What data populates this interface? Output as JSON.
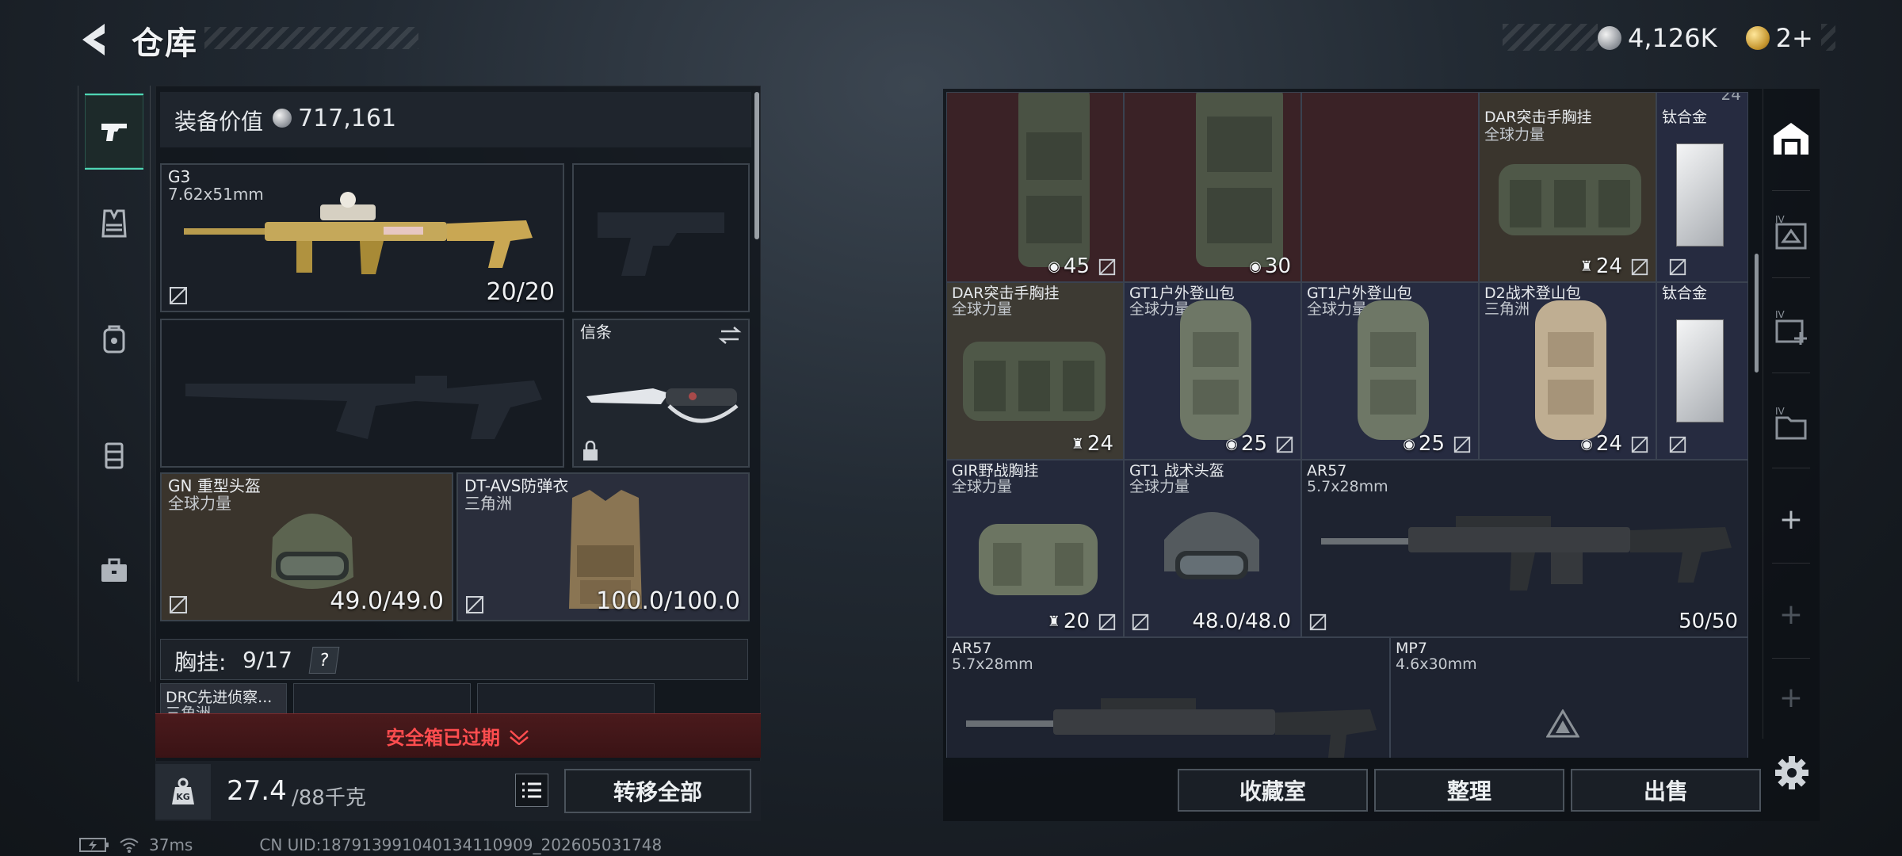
{
  "header": {
    "title": "仓库",
    "currency_silver": "4,126K",
    "currency_gold": "2+"
  },
  "left_rail": [
    "pistol-tab",
    "vest-tab",
    "backpack-tab",
    "case-tab",
    "toolbox-tab"
  ],
  "loadout": {
    "equip_value_label": "装备价值",
    "equip_value": "717,161",
    "primary": {
      "name": "G3",
      "caliber": "7.62x51mm",
      "ammo": "20/20"
    },
    "melee": {
      "name": "信条"
    },
    "helmet": {
      "name": "GN 重型头盔",
      "faction": "全球力量",
      "durability": "49.0/49.0"
    },
    "armor": {
      "name": "DT-AVS防弹衣",
      "faction": "三角洲",
      "durability": "100.0/100.0"
    },
    "chest_label": "胸挂:",
    "chest_count": "9/17",
    "chest_help": "?",
    "chest_item": "DRC先进侦察...",
    "chest_item_sub": "三角洲",
    "safe_case": "安全箱已过期",
    "weight_current": "27.4",
    "weight_max": "/88千克",
    "transfer_all": "转移全部"
  },
  "status_bar": {
    "ping": "37ms",
    "uid": "CN UID:187913991040134110909_202605031748"
  },
  "stash": {
    "top_right_count": "24",
    "cells": [
      {
        "id": "bag-1",
        "name": "",
        "sub": "",
        "count": "45",
        "count_icon": "bag-icon",
        "lock": true
      },
      {
        "id": "bag-2",
        "name": "",
        "sub": "",
        "count": "30",
        "count_icon": "bag-icon",
        "lock": false
      },
      {
        "id": "dar-1",
        "name": "DAR突击手胸挂",
        "sub": "全球力量",
        "count": "24",
        "count_icon": "vest-small-icon",
        "lock": true
      },
      {
        "id": "ti-1",
        "name": "钛合金",
        "sub": "",
        "count": "",
        "lock": true
      },
      {
        "id": "dar-2",
        "name": "DAR突击手胸挂",
        "sub": "全球力量",
        "count": "24",
        "count_icon": "vest-small-icon",
        "lock": false
      },
      {
        "id": "gt1-1",
        "name": "GT1户外登山包",
        "sub": "全球力量",
        "count": "25",
        "count_icon": "bag-icon",
        "lock": true
      },
      {
        "id": "gt1-2",
        "name": "GT1户外登山包",
        "sub": "全球力量",
        "count": "25",
        "count_icon": "bag-icon",
        "lock": true
      },
      {
        "id": "d2",
        "name": "D2战术登山包",
        "sub": "三角洲",
        "count": "24",
        "count_icon": "bag-icon",
        "lock": true
      },
      {
        "id": "ti-2",
        "name": "钛合金",
        "sub": "",
        "count": "",
        "lock": true
      },
      {
        "id": "gir",
        "name": "GIR野战胸挂",
        "sub": "全球力量",
        "count": "20",
        "count_icon": "vest-small-icon",
        "lock": true
      },
      {
        "id": "gt1-helmet",
        "name": "GT1 战术头盔",
        "sub": "全球力量",
        "count": "48.0/48.0",
        "count_icon": "",
        "lock": true
      },
      {
        "id": "ar57-1",
        "name": "AR57",
        "sub": "5.7x28mm",
        "count": "50/50",
        "count_icon": "",
        "lock": true
      },
      {
        "id": "ar57-2",
        "name": "AR57",
        "sub": "5.7x28mm",
        "count": "",
        "lock": false
      },
      {
        "id": "mp7",
        "name": "MP7",
        "sub": "4.6x30mm",
        "count": "",
        "lock": false
      }
    ]
  },
  "bottom_buttons": {
    "collection": "收藏室",
    "organize": "整理",
    "sell": "出售"
  },
  "right_rail": {
    "plus": "+"
  },
  "colors": {
    "accent": "#4fd6b5",
    "danger": "#ff4d4f",
    "gold": "#c5962f"
  }
}
